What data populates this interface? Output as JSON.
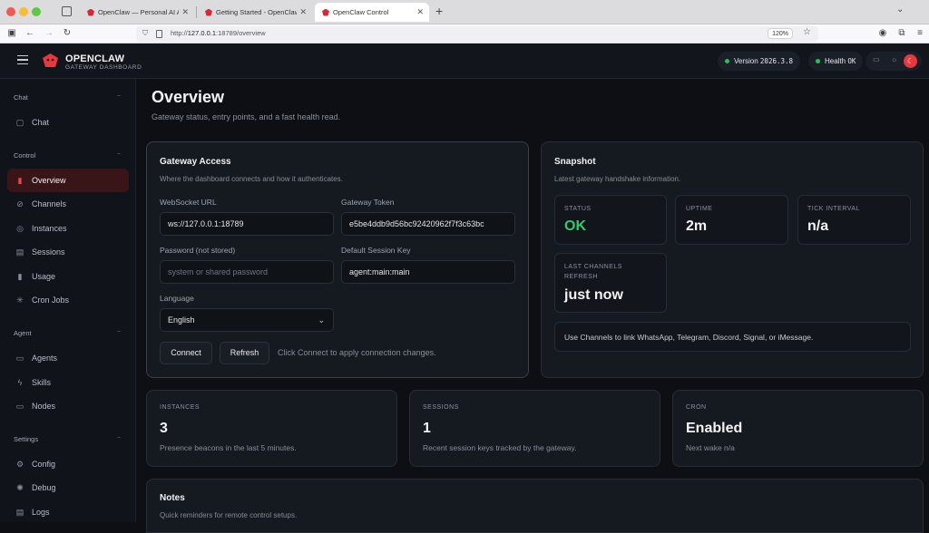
{
  "browser": {
    "tabs": [
      {
        "title": "OpenClaw — Personal AI Assistant",
        "active": false
      },
      {
        "title": "Getting Started - OpenClaw",
        "active": false
      },
      {
        "title": "OpenClaw Control",
        "active": true
      }
    ],
    "url_prefix": "http://",
    "url_host": "127.0.0.1",
    "url_rest": ":18789/overview",
    "zoom": "120%"
  },
  "header": {
    "brand": "OPENCLAW",
    "brand_sub": "GATEWAY DASHBOARD",
    "version_label": "Version",
    "version_value": "2026.3.8",
    "health_label": "Health",
    "health_value": "OK",
    "status_color": "#25c15c",
    "accent": "#e5393f"
  },
  "sidebar": {
    "sections": [
      {
        "title": "Chat",
        "items": [
          {
            "label": "Chat",
            "icon": "chat-bubble-icon"
          }
        ]
      },
      {
        "title": "Control",
        "items": [
          {
            "label": "Overview",
            "icon": "bar-chart-icon",
            "active": true
          },
          {
            "label": "Channels",
            "icon": "link-icon"
          },
          {
            "label": "Instances",
            "icon": "radio-icon"
          },
          {
            "label": "Sessions",
            "icon": "document-icon"
          },
          {
            "label": "Usage",
            "icon": "bar-chart-icon"
          },
          {
            "label": "Cron Jobs",
            "icon": "loader-icon"
          }
        ]
      },
      {
        "title": "Agent",
        "items": [
          {
            "label": "Agents",
            "icon": "folder-icon"
          },
          {
            "label": "Skills",
            "icon": "lightning-icon"
          },
          {
            "label": "Nodes",
            "icon": "monitor-icon"
          }
        ]
      },
      {
        "title": "Settings",
        "items": [
          {
            "label": "Config",
            "icon": "gear-icon"
          },
          {
            "label": "Debug",
            "icon": "bug-icon"
          },
          {
            "label": "Logs",
            "icon": "file-text-icon"
          }
        ]
      }
    ]
  },
  "page": {
    "title": "Overview",
    "subtitle": "Gateway status, entry points, and a fast health read."
  },
  "gateway_access": {
    "title": "Gateway Access",
    "subtitle": "Where the dashboard connects and how it authenticates.",
    "ws_label": "WebSocket URL",
    "ws_value": "ws://127.0.0.1:18789",
    "token_label": "Gateway Token",
    "token_value": "e5be4ddb9d56bc92420962f7f3c63bc",
    "password_label": "Password (not stored)",
    "password_placeholder": "system or shared password",
    "session_label": "Default Session Key",
    "session_value": "agent:main:main",
    "language_label": "Language",
    "language_value": "English",
    "connect_label": "Connect",
    "refresh_label": "Refresh",
    "hint": "Click Connect to apply connection changes."
  },
  "snapshot": {
    "title": "Snapshot",
    "subtitle": "Latest gateway handshake information.",
    "status_label": "STATUS",
    "status_value": "OK",
    "status_color": "#2ecc6a",
    "uptime_label": "UPTIME",
    "uptime_value": "2m",
    "tick_label": "TICK INTERVAL",
    "tick_value": "n/a",
    "lcr_label_1": "LAST CHANNELS",
    "lcr_label_2": "REFRESH",
    "lcr_value": "just now",
    "hint": "Use Channels to link WhatsApp, Telegram, Discord, Signal, or iMessage."
  },
  "stats": [
    {
      "label": "INSTANCES",
      "value": "3",
      "desc": "Presence beacons in the last 5 minutes."
    },
    {
      "label": "SESSIONS",
      "value": "1",
      "desc": "Recent session keys tracked by the gateway."
    },
    {
      "label": "CRON",
      "value": "Enabled",
      "desc": "Next wake n/a"
    }
  ],
  "notes": {
    "title": "Notes",
    "subtitle": "Quick reminders for remote control setups."
  }
}
